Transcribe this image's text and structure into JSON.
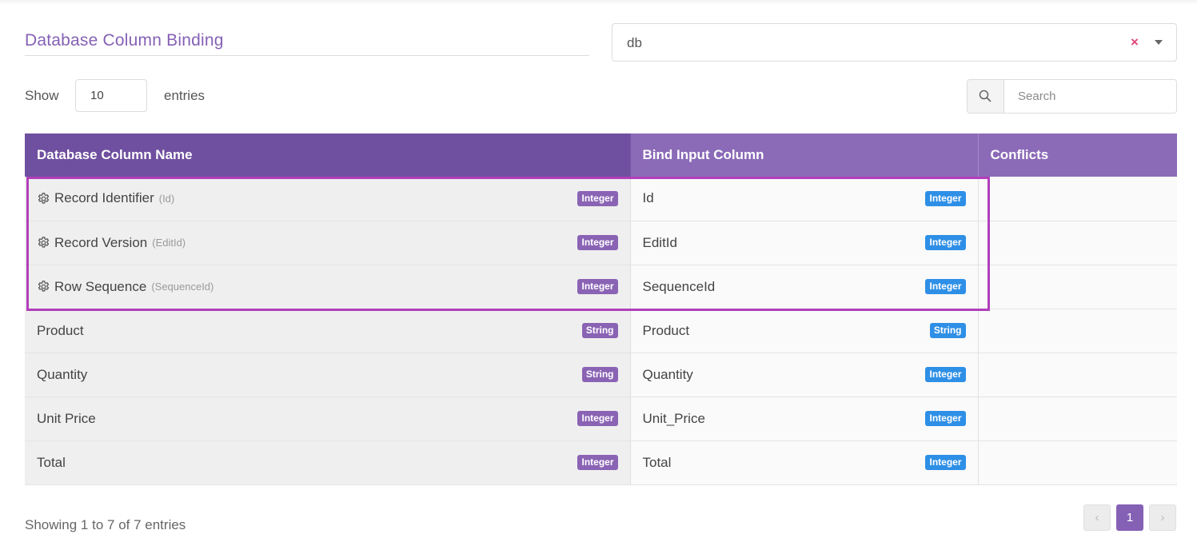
{
  "title": "Database Column Binding",
  "db_select": {
    "value": "db",
    "clear_symbol": "×"
  },
  "length": {
    "show_label": "Show",
    "value": "10",
    "entries_label": "entries"
  },
  "search": {
    "placeholder": "Search"
  },
  "columns": {
    "db_column": "Database Column Name",
    "bind_column": "Bind Input Column",
    "conflicts": "Conflicts"
  },
  "rows": [
    {
      "system": true,
      "name": "Record Identifier",
      "sub": "(Id)",
      "db_type": "Integer",
      "bind": "Id",
      "bind_type": "Integer",
      "conflicts": ""
    },
    {
      "system": true,
      "name": "Record Version",
      "sub": "(EditId)",
      "db_type": "Integer",
      "bind": "EditId",
      "bind_type": "Integer",
      "conflicts": ""
    },
    {
      "system": true,
      "name": "Row Sequence",
      "sub": "(SequenceId)",
      "db_type": "Integer",
      "bind": "SequenceId",
      "bind_type": "Integer",
      "conflicts": ""
    },
    {
      "system": false,
      "name": "Product",
      "sub": "",
      "db_type": "String",
      "bind": "Product",
      "bind_type": "String",
      "conflicts": ""
    },
    {
      "system": false,
      "name": "Quantity",
      "sub": "",
      "db_type": "String",
      "bind": "Quantity",
      "bind_type": "Integer",
      "conflicts": ""
    },
    {
      "system": false,
      "name": "Unit Price",
      "sub": "",
      "db_type": "Integer",
      "bind": "Unit_Price",
      "bind_type": "Integer",
      "conflicts": ""
    },
    {
      "system": false,
      "name": "Total",
      "sub": "",
      "db_type": "Integer",
      "bind": "Total",
      "bind_type": "Integer",
      "conflicts": ""
    }
  ],
  "footer": {
    "info": "Showing 1 to 7 of 7 entries"
  },
  "pagination": {
    "prev": "‹",
    "current": "1",
    "next": "›"
  },
  "colors": {
    "accent": "#8561b5",
    "header_dark": "#6f4f9f",
    "header_light": "#8b6ab8",
    "badge_db": "#8a63b4",
    "badge_bind": "#2e8fe6",
    "highlight": "#b13fba"
  },
  "icons": {
    "system_row": "gear-icon",
    "search": "search-icon",
    "clear": "close-icon",
    "dropdown": "chevron-down-icon"
  }
}
